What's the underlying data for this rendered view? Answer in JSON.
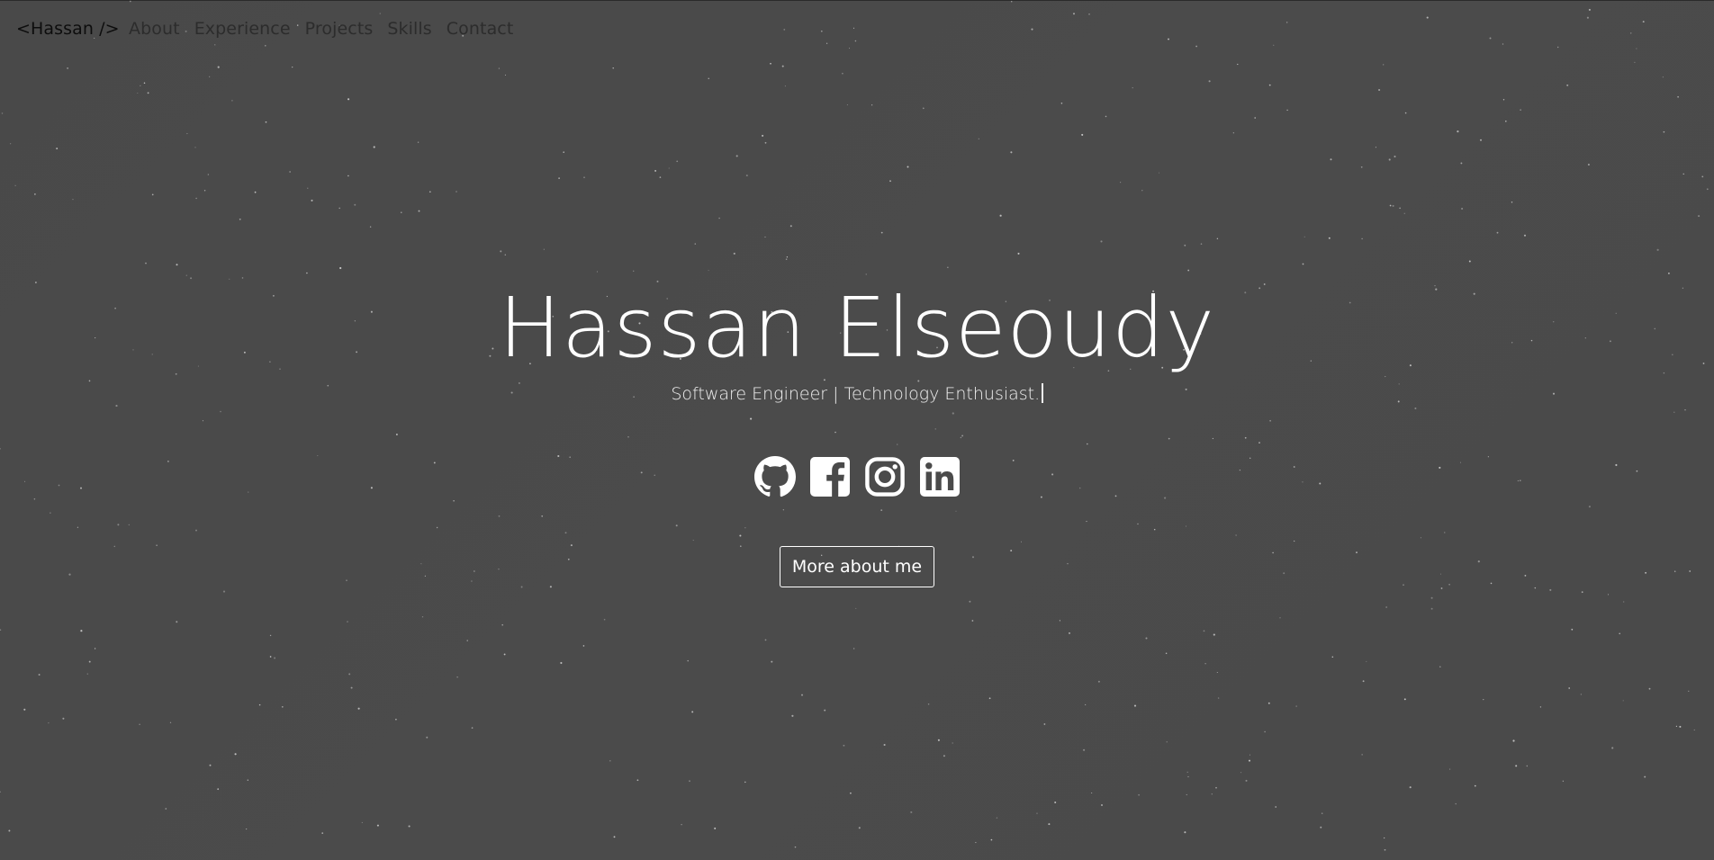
{
  "nav": {
    "brand": "<Hassan />",
    "links": [
      "About",
      "Experience",
      "Projects",
      "Skills",
      "Contact"
    ]
  },
  "hero": {
    "name": "Hassan Elseoudy",
    "tagline": "Software Engineer | Technology Enthusiast."
  },
  "socials": [
    {
      "icon": "github-icon"
    },
    {
      "icon": "facebook-icon"
    },
    {
      "icon": "instagram-icon"
    },
    {
      "icon": "linkedin-icon"
    }
  ],
  "cta": {
    "label": "More about me"
  },
  "colors": {
    "background": "#4a4a4a",
    "text": "#ffffff",
    "nav_text": "#2c2c2c",
    "brand_text": "#0d0d0d"
  }
}
